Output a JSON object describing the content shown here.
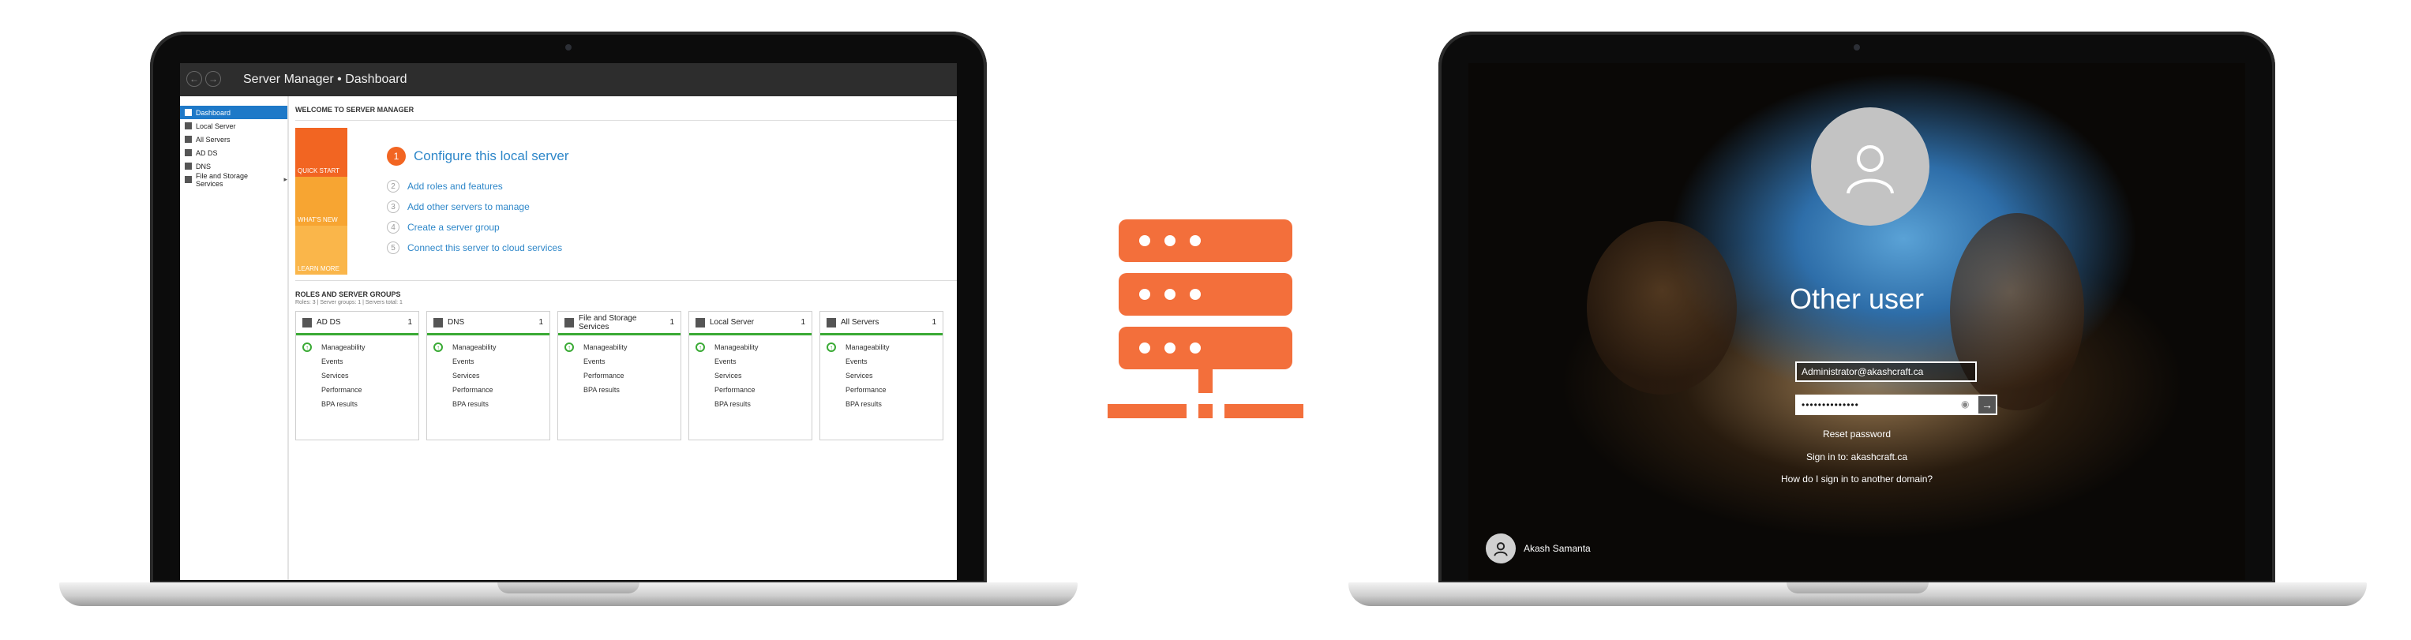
{
  "server_manager": {
    "title": "Server Manager • Dashboard",
    "sidebar": [
      {
        "label": "Dashboard",
        "active": true
      },
      {
        "label": "Local Server"
      },
      {
        "label": "All Servers"
      },
      {
        "label": "AD DS"
      },
      {
        "label": "DNS"
      },
      {
        "label": "File and Storage Services",
        "caret": "▸"
      }
    ],
    "welcome": "WELCOME TO SERVER MANAGER",
    "quick_start": [
      "QUICK START",
      "WHAT'S NEW",
      "LEARN MORE"
    ],
    "steps": [
      {
        "num": "1",
        "label": "Configure this local server"
      },
      {
        "num": "2",
        "label": "Add roles and features"
      },
      {
        "num": "3",
        "label": "Add other servers to manage"
      },
      {
        "num": "4",
        "label": "Create a server group"
      },
      {
        "num": "5",
        "label": "Connect this server to cloud services"
      }
    ],
    "roles_title": "ROLES AND SERVER GROUPS",
    "roles_sub": "Roles: 3  |  Server groups: 1  |  Servers total: 1",
    "tiles": [
      {
        "name": "AD DS",
        "count": "1",
        "rows": [
          "Manageability",
          "Events",
          "Services",
          "Performance",
          "BPA results"
        ]
      },
      {
        "name": "DNS",
        "count": "1",
        "rows": [
          "Manageability",
          "Events",
          "Services",
          "Performance",
          "BPA results"
        ]
      },
      {
        "name": "File and Storage Services",
        "count": "1",
        "rows": [
          "Manageability",
          "Events",
          "Performance",
          "BPA results"
        ]
      },
      {
        "name": "Local Server",
        "count": "1",
        "rows": [
          "Manageability",
          "Events",
          "Services",
          "Performance",
          "BPA results"
        ]
      },
      {
        "name": "All Servers",
        "count": "1",
        "rows": [
          "Manageability",
          "Events",
          "Services",
          "Performance",
          "BPA results"
        ]
      }
    ]
  },
  "login": {
    "user_title": "Other user",
    "username": "Administrator@akashcraft.ca",
    "password_mask": "••••••••••••••",
    "reset": "Reset password",
    "sign_in_to": "Sign in to: akashcraft.ca",
    "other_domain": "How do I sign in to another domain?",
    "account_name": "Akash Samanta"
  },
  "colors": {
    "accent": "#f36f3b",
    "ok": "#3aaa35",
    "link": "#2e87c9"
  }
}
